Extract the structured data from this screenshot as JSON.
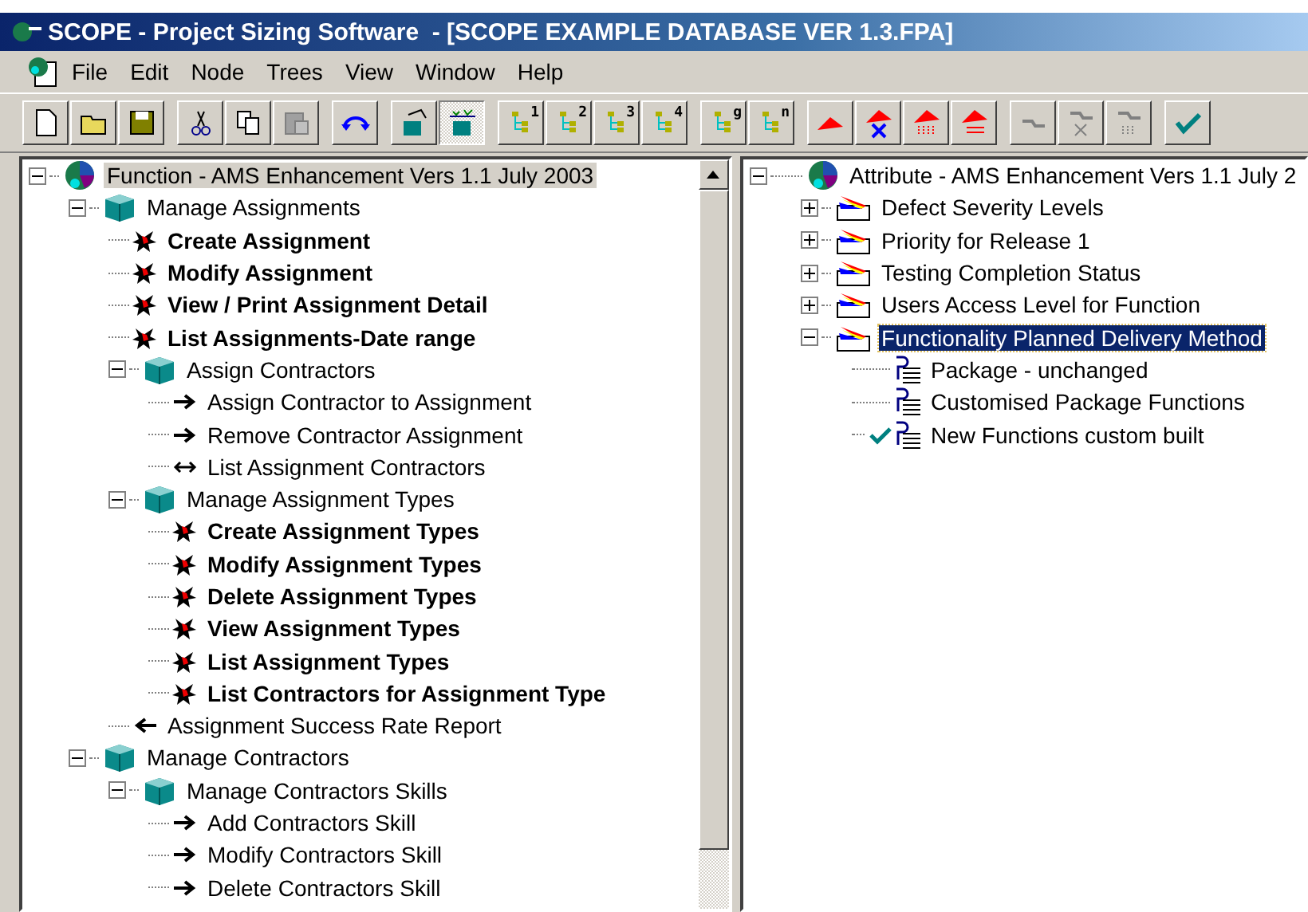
{
  "window": {
    "title": "SCOPE - Project Sizing Software  - [SCOPE EXAMPLE DATABASE VER 1.3.FPA]"
  },
  "menu": [
    "File",
    "Edit",
    "Node",
    "Trees",
    "View",
    "Window",
    "Help"
  ],
  "toolbar": [
    [
      {
        "kind": "new",
        "pressed": false
      },
      {
        "kind": "open",
        "pressed": false
      },
      {
        "kind": "save",
        "pressed": false
      }
    ],
    [
      {
        "kind": "cut",
        "pressed": false
      },
      {
        "kind": "copy",
        "pressed": false
      },
      {
        "kind": "paste",
        "pressed": false
      }
    ],
    [
      {
        "kind": "undo",
        "pressed": false
      }
    ],
    [
      {
        "kind": "link-node",
        "pressed": false
      },
      {
        "kind": "attr-node",
        "pressed": true
      }
    ],
    [
      {
        "kind": "level",
        "label": "1",
        "pressed": false
      },
      {
        "kind": "level",
        "label": "2",
        "pressed": false
      },
      {
        "kind": "level",
        "label": "3",
        "pressed": false
      },
      {
        "kind": "level",
        "label": "4",
        "pressed": false
      }
    ],
    [
      {
        "kind": "level",
        "label": "g",
        "pressed": false
      },
      {
        "kind": "level",
        "label": "n",
        "pressed": false
      }
    ],
    [
      {
        "kind": "flag",
        "pressed": false
      },
      {
        "kind": "flag-delete",
        "pressed": false
      },
      {
        "kind": "flag-grid",
        "pressed": false
      },
      {
        "kind": "flag-list",
        "pressed": false
      }
    ],
    [
      {
        "kind": "chain",
        "pressed": false
      },
      {
        "kind": "chain-delete",
        "pressed": false
      },
      {
        "kind": "chain-grid",
        "pressed": false
      }
    ],
    [
      {
        "kind": "check",
        "pressed": false
      }
    ]
  ],
  "function_tree": {
    "focused": false,
    "items": [
      {
        "kind": "root",
        "label": "Function - AMS Enhancement Vers 1.1 July 2003",
        "selected": true,
        "expanded": true,
        "children": [
          {
            "kind": "group",
            "label": "Manage Assignments",
            "selected": false,
            "expanded": true,
            "children": [
              {
                "kind": "function",
                "label": "Create Assignment",
                "selected": false
              },
              {
                "kind": "function",
                "label": "Modify Assignment",
                "selected": false
              },
              {
                "kind": "function",
                "label": "View / Print Assignment Detail",
                "selected": false
              },
              {
                "kind": "function",
                "label": "List Assignments-Date range",
                "selected": false
              },
              {
                "kind": "group",
                "label": "Assign Contractors",
                "selected": false,
                "expanded": true,
                "children": [
                  {
                    "kind": "arrow-right",
                    "label": "Assign Contractor to Assignment",
                    "selected": false
                  },
                  {
                    "kind": "arrow-right",
                    "label": "Remove Contractor  Assignment",
                    "selected": false
                  },
                  {
                    "kind": "arrow-both",
                    "label": "List Assignment Contractors",
                    "selected": false
                  }
                ]
              },
              {
                "kind": "group",
                "label": "Manage Assignment Types",
                "selected": false,
                "expanded": true,
                "children": [
                  {
                    "kind": "function",
                    "label": "Create Assignment Types",
                    "selected": false
                  },
                  {
                    "kind": "function",
                    "label": "Modify Assignment Types",
                    "selected": false
                  },
                  {
                    "kind": "function",
                    "label": "Delete Assignment Types",
                    "selected": false
                  },
                  {
                    "kind": "function",
                    "label": "View Assignment Types",
                    "selected": false
                  },
                  {
                    "kind": "function",
                    "label": "List Assignment Types",
                    "selected": false
                  },
                  {
                    "kind": "function",
                    "label": "List Contractors for Assignment Type",
                    "selected": false
                  }
                ]
              },
              {
                "kind": "arrow-left",
                "label": "Assignment Success Rate Report",
                "selected": false
              }
            ]
          },
          {
            "kind": "group",
            "label": "Manage Contractors",
            "selected": false,
            "expanded": true,
            "children": [
              {
                "kind": "group",
                "label": "Manage Contractors Skills",
                "selected": false,
                "expanded": true,
                "children": [
                  {
                    "kind": "arrow-right",
                    "label": "Add Contractors Skill",
                    "selected": false
                  },
                  {
                    "kind": "arrow-right",
                    "label": "Modify Contractors Skill",
                    "selected": false
                  },
                  {
                    "kind": "arrow-right",
                    "label": "Delete Contractors Skill",
                    "selected": false
                  }
                ]
              }
            ]
          }
        ]
      }
    ]
  },
  "attribute_tree": {
    "focused": true,
    "items": [
      {
        "kind": "root",
        "label": "Attribute - AMS Enhancement Vers 1.1 July 2",
        "selected": false,
        "expanded": true,
        "children": [
          {
            "kind": "attribute",
            "label": "Defect Severity Levels",
            "selected": false,
            "expanded": false
          },
          {
            "kind": "attribute",
            "label": "Priority for Release 1",
            "selected": false,
            "expanded": false
          },
          {
            "kind": "attribute",
            "label": "Testing Completion Status",
            "selected": false,
            "expanded": false
          },
          {
            "kind": "attribute",
            "label": "Users Access Level for Function",
            "selected": false,
            "expanded": false
          },
          {
            "kind": "attribute",
            "label": "Functionality Planned Delivery Method",
            "selected": true,
            "expanded": true,
            "children": [
              {
                "kind": "value",
                "label": "Package - unchanged",
                "selected": false,
                "checked": false
              },
              {
                "kind": "value",
                "label": "Customised Package Functions",
                "selected": false,
                "checked": false
              },
              {
                "kind": "value",
                "label": "New Functions custom built",
                "selected": false,
                "checked": true
              }
            ]
          }
        ]
      }
    ]
  }
}
